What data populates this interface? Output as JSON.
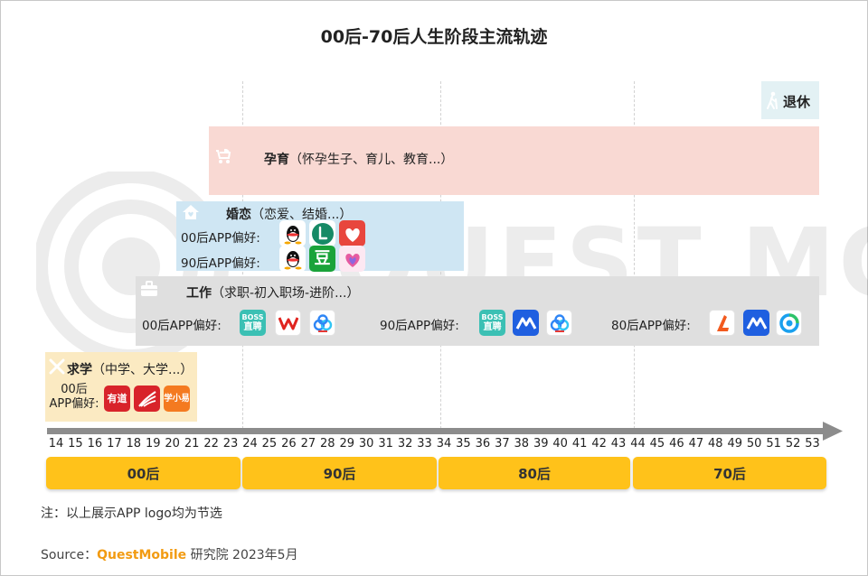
{
  "title": "00后-70后人生阶段主流轨迹",
  "chart_data": {
    "type": "timeline",
    "title": "00后-70后人生阶段主流轨迹",
    "x": [
      14,
      15,
      16,
      17,
      18,
      19,
      20,
      21,
      22,
      23,
      24,
      25,
      26,
      27,
      28,
      29,
      30,
      31,
      32,
      33,
      34,
      35,
      36,
      37,
      38,
      39,
      40,
      41,
      42,
      43,
      44,
      45,
      46,
      47,
      48,
      49,
      50,
      51,
      52,
      53
    ],
    "generations": [
      {
        "name": "00后",
        "range": [
          14,
          23
        ]
      },
      {
        "name": "90后",
        "range": [
          24,
          33
        ]
      },
      {
        "name": "80后",
        "range": [
          34,
          43
        ]
      },
      {
        "name": "70后",
        "range": [
          44,
          53
        ]
      }
    ],
    "stages": [
      {
        "name": "退休",
        "detail": "",
        "range": [
          52,
          53
        ]
      },
      {
        "name": "孕育",
        "detail": "（怀孕生子、育儿、教育...）",
        "range": [
          22,
          53
        ]
      },
      {
        "name": "婚恋",
        "detail": "（恋爱、结婚...）",
        "range": [
          20,
          33
        ]
      },
      {
        "name": "工作",
        "detail": "（求职-初入职场-进阶...）",
        "range": [
          19,
          53
        ]
      },
      {
        "name": "求学",
        "detail": "（中学、大学...）",
        "range": [
          14,
          21
        ]
      }
    ],
    "app_preferences": {
      "marriage": [
        {
          "group": "00后APP偏好:",
          "apps": [
            "qq-icon",
            "soul-icon",
            "heart-dating-icon"
          ]
        },
        {
          "group": "90后APP偏好:",
          "apps": [
            "qq-icon",
            "douban-icon",
            "baihe-icon"
          ]
        }
      ],
      "work": [
        {
          "group": "00后APP偏好:",
          "apps": [
            "boss-zhipin-icon",
            "wps-icon",
            "baidu-netdisk-icon"
          ]
        },
        {
          "group": "90后APP偏好:",
          "apps": [
            "boss-zhipin-icon",
            "maimai-icon",
            "baidu-netdisk-icon"
          ]
        },
        {
          "group": "80后APP偏好:",
          "apps": [
            "liepin-icon",
            "maimai-icon",
            "wechat-work-icon"
          ]
        }
      ],
      "study": [
        {
          "group": "00后APP偏好:",
          "apps": [
            "youdao-icon",
            "xuexitong-icon",
            "xuexiaoyi-icon"
          ]
        }
      ]
    },
    "colors": {
      "retire": "#e3f1f4",
      "parenting": "#f9d9d3",
      "marriage": "#cfe6f3",
      "work": "#dfdfdf",
      "study": "#fbeac2",
      "generation": "#ffc21a",
      "axis": "#8c8c8c"
    }
  },
  "stage_labels": {
    "retire": {
      "name": "退休"
    },
    "parenting": {
      "name": "孕育",
      "detail": "（怀孕生子、育儿、教育...）"
    },
    "marriage": {
      "name": "婚恋",
      "detail": "（恋爱、结婚...）"
    },
    "work": {
      "name": "工作",
      "detail": "（求职-初入职场-进阶...）"
    },
    "study": {
      "name": "求学",
      "detail": "（中学、大学...）"
    }
  },
  "prefs": {
    "marriage_00": "00后APP偏好:",
    "marriage_90": "90后APP偏好:",
    "work_00": "00后APP偏好:",
    "work_90": "90后APP偏好:",
    "work_80": "80后APP偏好:",
    "study_00_line1": "00后",
    "study_00_line2": "APP偏好:"
  },
  "app_text": {
    "boss_line1": "BOSS",
    "boss_line2": "直聘",
    "douban": "豆",
    "youdao": "有道",
    "xuexiaoyi": "学小易"
  },
  "watermark": "QUEST MOBILE",
  "note": "注：以上展示APP logo均为节选",
  "source": {
    "label": "Source：",
    "brand": "QuestMobile",
    "rest": " 研究院 2023年5月"
  }
}
